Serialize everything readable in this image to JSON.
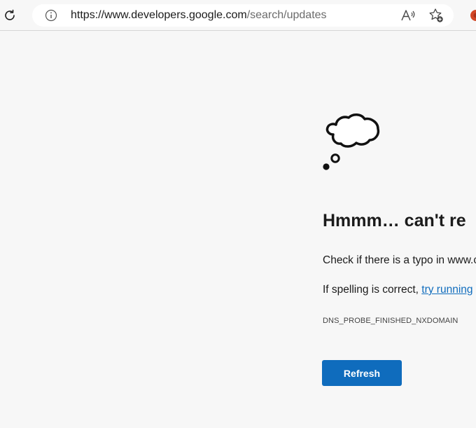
{
  "browser": {
    "address_bar": {
      "url_host": "https://www.developers.google.com",
      "url_path": "/search/updates"
    },
    "icons": {
      "refresh": "refresh-icon",
      "site_info": "info-icon",
      "read_aloud": "read-aloud-icon",
      "favorites": "add-favorite-icon",
      "extension": "extension-icon"
    }
  },
  "error_page": {
    "icon": "thought-bubble-icon",
    "title": "Hmmm… can't re",
    "line1": "Check if there is a typo in www.c",
    "line2_prefix": "If spelling is correct, ",
    "line2_link": "try running",
    "error_code": "DNS_PROBE_FINISHED_NXDOMAIN",
    "refresh_label": "Refresh"
  },
  "colors": {
    "accent": "#0f6cbd",
    "page_background": "#f7f7f7"
  }
}
